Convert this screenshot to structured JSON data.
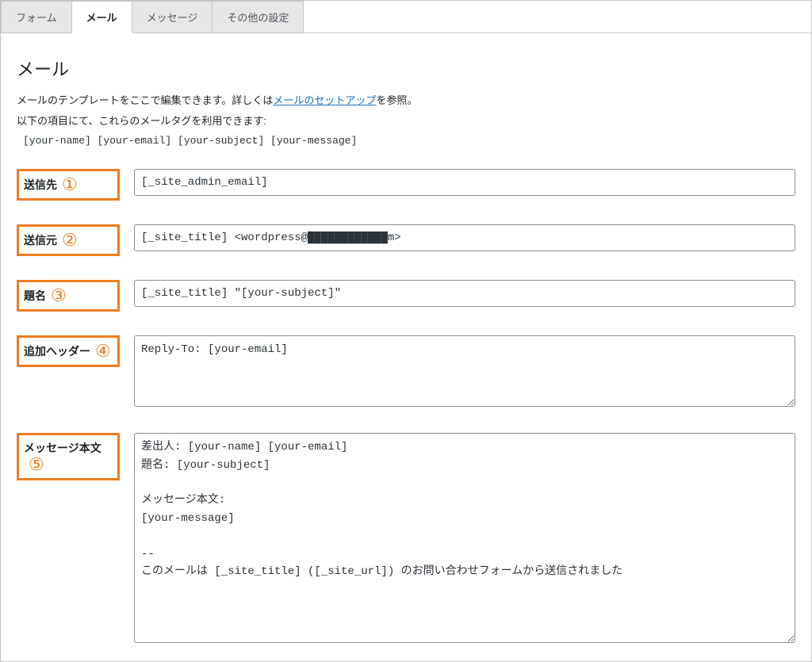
{
  "tabs": [
    {
      "label": "フォーム"
    },
    {
      "label": "メール"
    },
    {
      "label": "メッセージ"
    },
    {
      "label": "その他の設定"
    }
  ],
  "section": {
    "title": "メール",
    "desc_before_link": "メールのテンプレートをここで編集できます。詳しくは",
    "desc_link": "メールのセットアップ",
    "desc_after_link": "を参照。",
    "tags_intro": "以下の項目にて、これらのメールタグを利用できます:",
    "mail_tags": "[your-name] [your-email] [your-subject] [your-message]"
  },
  "annotations": {
    "n1": "①",
    "n2": "②",
    "n3": "③",
    "n4": "④",
    "n5": "⑤"
  },
  "fields": {
    "to": {
      "label": "送信先",
      "value": "[_site_admin_email]"
    },
    "from": {
      "label": "送信元",
      "value": "[_site_title] <wordpress@████████████m>"
    },
    "subject": {
      "label": "題名",
      "value": "[_site_title] \"[your-subject]\""
    },
    "headers": {
      "label": "追加ヘッダー",
      "value": "Reply-To: [your-email]"
    },
    "body": {
      "label": "メッセージ本文",
      "value": "差出人: [your-name] [your-email]\n題名: [your-subject]\n\nメッセージ本文:\n[your-message]\n\n-- \nこのメールは [_site_title] ([_site_url]) のお問い合わせフォームから送信されました"
    }
  }
}
